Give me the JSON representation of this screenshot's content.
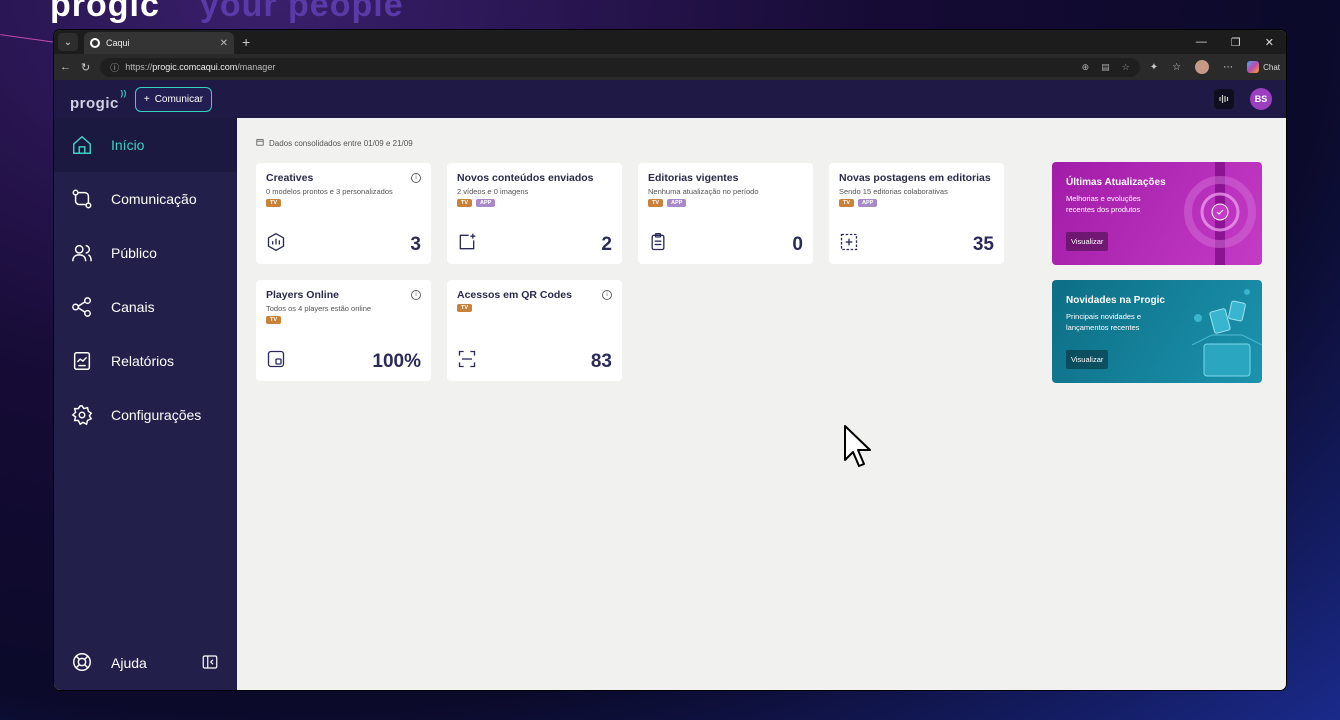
{
  "background": {
    "brand": "progic",
    "tagline": "your people"
  },
  "browser": {
    "tab_title": "Caqui",
    "url_scheme": "https://",
    "url_host": "progic.comcaqui.com",
    "url_path": "/manager",
    "chat_label": "Chat"
  },
  "header": {
    "logo": "progic",
    "comunicar_label": "Comunicar",
    "user_initials": "BS"
  },
  "sidebar": {
    "items": [
      {
        "label": "Início",
        "icon": "home-icon"
      },
      {
        "label": "Comunicação",
        "icon": "route-icon"
      },
      {
        "label": "Público",
        "icon": "users-icon"
      },
      {
        "label": "Canais",
        "icon": "share-icon"
      },
      {
        "label": "Relatórios",
        "icon": "chart-icon"
      },
      {
        "label": "Configurações",
        "icon": "gear-icon"
      }
    ],
    "footer_label": "Ajuda"
  },
  "main": {
    "dates_text": "Dados consolidados entre 01/09 e 21/09",
    "cards": [
      {
        "title": "Creatives",
        "sub": "0 modelos prontos e 3 personalizados",
        "badges": [
          "TV"
        ],
        "value": "3"
      },
      {
        "title": "Novos conteúdos enviados",
        "sub": "2 vídeos e 0 imagens",
        "badges": [
          "TV",
          "APP"
        ],
        "value": "2"
      },
      {
        "title": "Editorias vigentes",
        "sub": "Nenhuma atualização no período",
        "badges": [
          "TV",
          "APP"
        ],
        "value": "0"
      },
      {
        "title": "Novas postagens em editorias",
        "sub": "Sendo 15 editorias colaborativas",
        "badges": [
          "TV",
          "APP"
        ],
        "value": "35"
      },
      {
        "title": "Players Online",
        "sub": "Todos os 4 players estão online",
        "badges": [
          "TV"
        ],
        "value": "100%"
      },
      {
        "title": "Acessos em QR Codes",
        "sub": "",
        "badges": [
          "TV"
        ],
        "value": "83"
      }
    ],
    "promos": [
      {
        "title": "Últimas Atualizações",
        "desc": "Melhorias e evoluções recentes dos produtos",
        "button": "Visualizar"
      },
      {
        "title": "Novidades na Progic",
        "desc": "Principais novidades e lançamentos recentes",
        "button": "Visualizar"
      }
    ]
  },
  "colors": {
    "accent": "#3ad0c0",
    "sidebar": "#22204a",
    "header": "#1e1a45",
    "card_value": "#2b2b5a"
  }
}
